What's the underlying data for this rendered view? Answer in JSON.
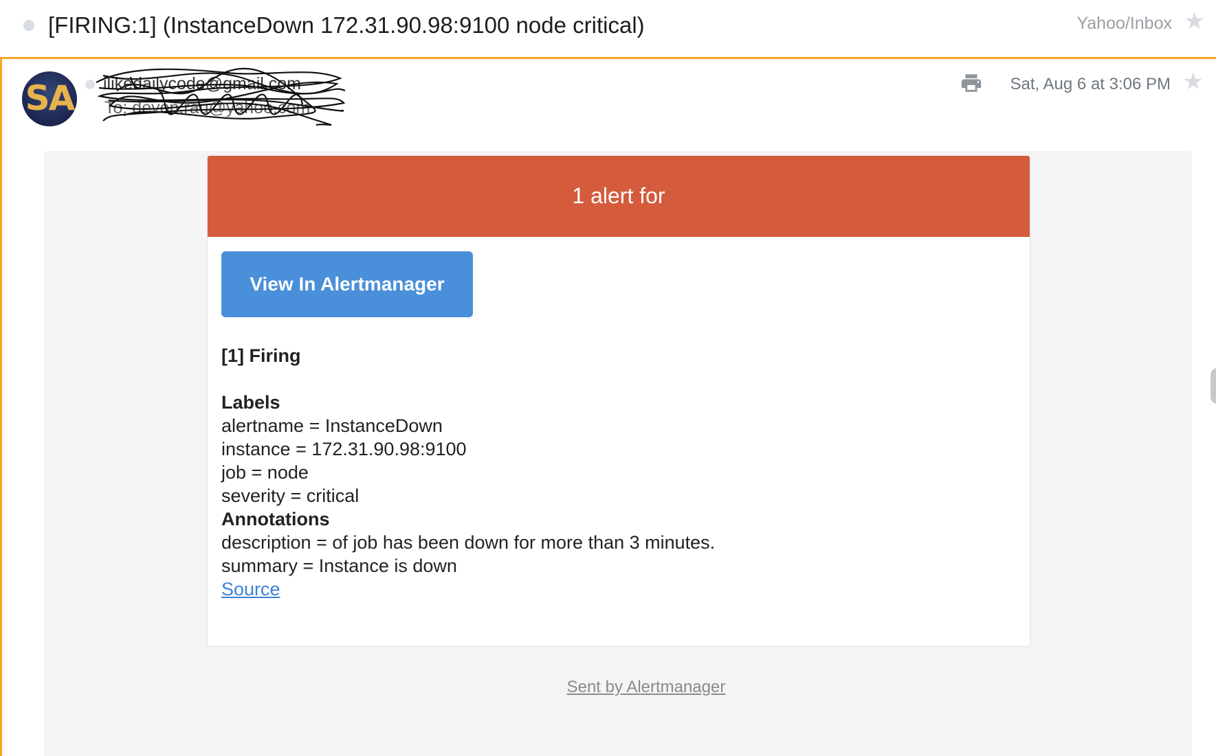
{
  "header": {
    "subject": "[FIRING:1] (InstanceDown 172.31.90.98:9100 node critical)",
    "folder": "Yahoo/Inbox"
  },
  "message": {
    "avatar_initials": "SA",
    "sender": "ilikedailycode@gmail.com",
    "recipient": "To: devon.rau@yahoo.com",
    "date": "Sat, Aug 6 at 3:06 PM"
  },
  "email": {
    "banner": "1 alert for",
    "view_button": "View In Alertmanager",
    "firing_heading": "[1] Firing",
    "labels_heading": "Labels",
    "labels": [
      "alertname = InstanceDown",
      "instance = 172.31.90.98:9100",
      "job = node",
      "severity = critical"
    ],
    "annotations_heading": "Annotations",
    "annotations": [
      "description = of job has been down for more than 3 minutes.",
      "summary = Instance is down"
    ],
    "source_link": "Source",
    "footer": "Sent by Alertmanager"
  },
  "colors": {
    "accent": "#f5a623",
    "banner": "#d45c3c",
    "button": "#4a8fd9",
    "link": "#3b82d6"
  },
  "icons": [
    "star-icon",
    "print-icon"
  ]
}
